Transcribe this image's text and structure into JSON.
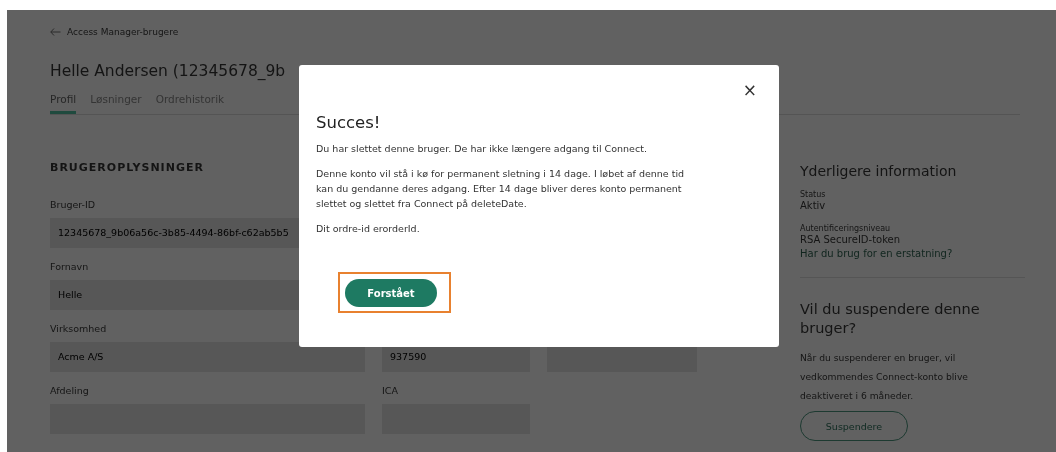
{
  "breadcrumb": {
    "label": "Access Manager-brugere"
  },
  "page_title": "Helle Andersen (12345678_9b",
  "tabs": [
    {
      "label": "Profil",
      "selected": true
    },
    {
      "label": "Løsninger",
      "selected": false
    },
    {
      "label": "Ordrehistorik",
      "selected": false
    }
  ],
  "section_heading": "BRUGEROPLYSNINGER",
  "form_rows": [
    {
      "cells": [
        {
          "label": "Bruger-ID",
          "value": "12345678_9b06a56c-3b85-4494-86bf-c62ab5b5"
        }
      ]
    },
    {
      "cells": [
        {
          "label": "Fornavn",
          "value": "Helle"
        }
      ]
    },
    {
      "cells": [
        {
          "label": "Virksomhed",
          "value": "Acme A/S"
        },
        {
          "value": "937590"
        },
        {}
      ]
    },
    {
      "cells": [
        {
          "label": "Afdeling"
        },
        {
          "label": "ICA"
        }
      ]
    }
  ],
  "info_panel": {
    "title": "Yderligere information",
    "items": [
      {
        "label": "Status",
        "value": "Aktiv"
      },
      {
        "label": "Autentificeringsniveau",
        "value": "RSA SecureID-token",
        "link": "Har du brug for en erstatning?"
      }
    ]
  },
  "suspend_panel": {
    "title": "Vil du suspendere denne bruger?",
    "text": "Når du suspenderer en bruger, vil vedkommendes Connect-konto blive deaktiveret i 6 måneder.",
    "button": "Suspendere"
  },
  "dialog": {
    "close": "×",
    "title": "Succes!",
    "paragraphs": [
      "Du har slettet denne bruger. De har ikke længere adgang til Connect.",
      "Denne konto vil stå i kø for permanent sletning i 14 dage. I løbet af denne tid kan du gendanne deres adgang. Efter 14 dage bliver deres konto permanent slettet og slettet fra Connect på deleteDate.",
      "Dit ordre-id erorderId."
    ],
    "button": {
      "label": "Forstået",
      "highlighted": true
    }
  }
}
